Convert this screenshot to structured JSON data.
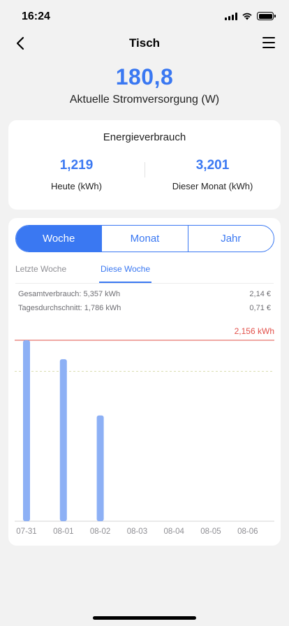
{
  "status": {
    "time": "16:24"
  },
  "nav": {
    "title": "Tisch",
    "back_icon": "chevron-left-icon",
    "menu_icon": "hamburger-menu-icon"
  },
  "hero": {
    "value": "180,8",
    "label": "Aktuelle Stromversorgung (W)"
  },
  "energy": {
    "title": "Energieverbrauch",
    "today_value": "1,219",
    "today_label": "Heute (kWh)",
    "month_value": "3,201",
    "month_label": "Dieser Monat (kWh)"
  },
  "period_tabs": [
    {
      "label": "Woche",
      "active": true
    },
    {
      "label": "Monat",
      "active": false
    },
    {
      "label": "Jahr",
      "active": false
    }
  ],
  "week_tabs": [
    {
      "label": "Letzte Woche",
      "active": false
    },
    {
      "label": "Diese Woche",
      "active": true
    }
  ],
  "summary": {
    "total_label": "Gesamtverbrauch: 5,357 kWh",
    "total_cost": "2,14 €",
    "avg_label": "Tagesdurchschnitt: 1,786 kWh",
    "avg_cost": "0,71 €"
  },
  "colors": {
    "accent": "#3a78f2",
    "bar": "#8db0f5",
    "max_line": "#e2504a",
    "avg_line": "#d9dcb0"
  },
  "chart_data": {
    "type": "bar",
    "categories": [
      "07-31",
      "08-01",
      "08-02",
      "08-03",
      "08-04",
      "08-05",
      "08-06"
    ],
    "values": [
      2.156,
      1.93,
      1.26,
      0,
      0,
      0,
      0
    ],
    "max_value": 2.156,
    "max_label": "2,156 kWh",
    "average": 1.786,
    "ylim": [
      0,
      2.156
    ],
    "grid": false
  }
}
